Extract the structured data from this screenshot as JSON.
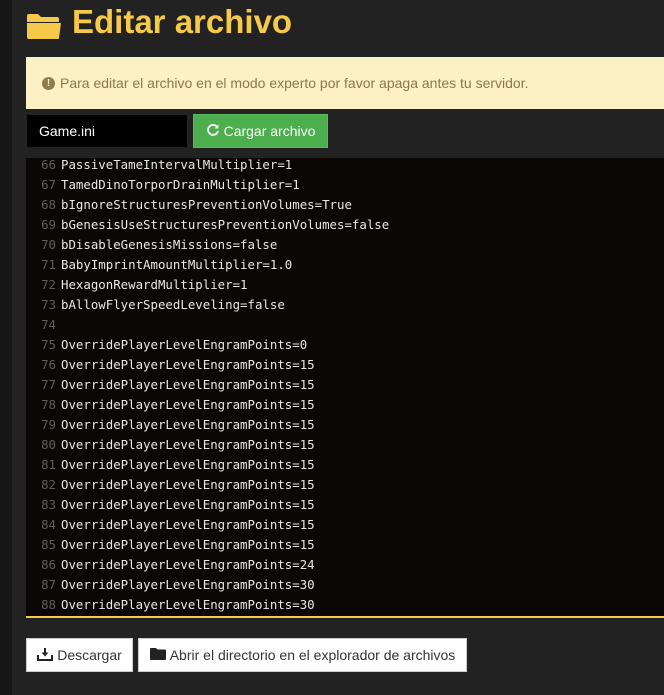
{
  "header": {
    "title": "Editar archivo",
    "icon": "folder-open-icon",
    "accent_color": "#f7c948"
  },
  "alert": {
    "icon": "exclamation-circle-icon",
    "text": "Para editar el archivo en el modo experto por favor apaga antes tu servidor."
  },
  "file_picker": {
    "value": "Game.ini"
  },
  "load_button": {
    "label": "Cargar archivo",
    "icon": "refresh-icon",
    "color": "#4cae4c"
  },
  "editor": {
    "lines": [
      {
        "num": "66",
        "text": "PassiveTameIntervalMultiplier=1"
      },
      {
        "num": "67",
        "text": "TamedDinoTorporDrainMultiplier=1"
      },
      {
        "num": "68",
        "text": "bIgnoreStructuresPreventionVolumes=True"
      },
      {
        "num": "69",
        "text": "bGenesisUseStructuresPreventionVolumes=false"
      },
      {
        "num": "70",
        "text": "bDisableGenesisMissions=false"
      },
      {
        "num": "71",
        "text": "BabyImprintAmountMultiplier=1.0"
      },
      {
        "num": "72",
        "text": "HexagonRewardMultiplier=1"
      },
      {
        "num": "73",
        "text": "bAllowFlyerSpeedLeveling=false"
      },
      {
        "num": "74",
        "text": ""
      },
      {
        "num": "75",
        "text": "OverridePlayerLevelEngramPoints=0"
      },
      {
        "num": "76",
        "text": "OverridePlayerLevelEngramPoints=15"
      },
      {
        "num": "77",
        "text": "OverridePlayerLevelEngramPoints=15"
      },
      {
        "num": "78",
        "text": "OverridePlayerLevelEngramPoints=15"
      },
      {
        "num": "79",
        "text": "OverridePlayerLevelEngramPoints=15"
      },
      {
        "num": "80",
        "text": "OverridePlayerLevelEngramPoints=15"
      },
      {
        "num": "81",
        "text": "OverridePlayerLevelEngramPoints=15"
      },
      {
        "num": "82",
        "text": "OverridePlayerLevelEngramPoints=15"
      },
      {
        "num": "83",
        "text": "OverridePlayerLevelEngramPoints=15"
      },
      {
        "num": "84",
        "text": "OverridePlayerLevelEngramPoints=15"
      },
      {
        "num": "85",
        "text": "OverridePlayerLevelEngramPoints=15"
      },
      {
        "num": "86",
        "text": "OverridePlayerLevelEngramPoints=24"
      },
      {
        "num": "87",
        "text": "OverridePlayerLevelEngramPoints=30"
      },
      {
        "num": "88",
        "text": "OverridePlayerLevelEngramPoints=30"
      }
    ]
  },
  "footer": {
    "download_label": "Descargar",
    "download_icon": "download-icon",
    "explorer_label": "Abrir el directorio en el explorador de archivos",
    "explorer_icon": "folder-icon"
  }
}
